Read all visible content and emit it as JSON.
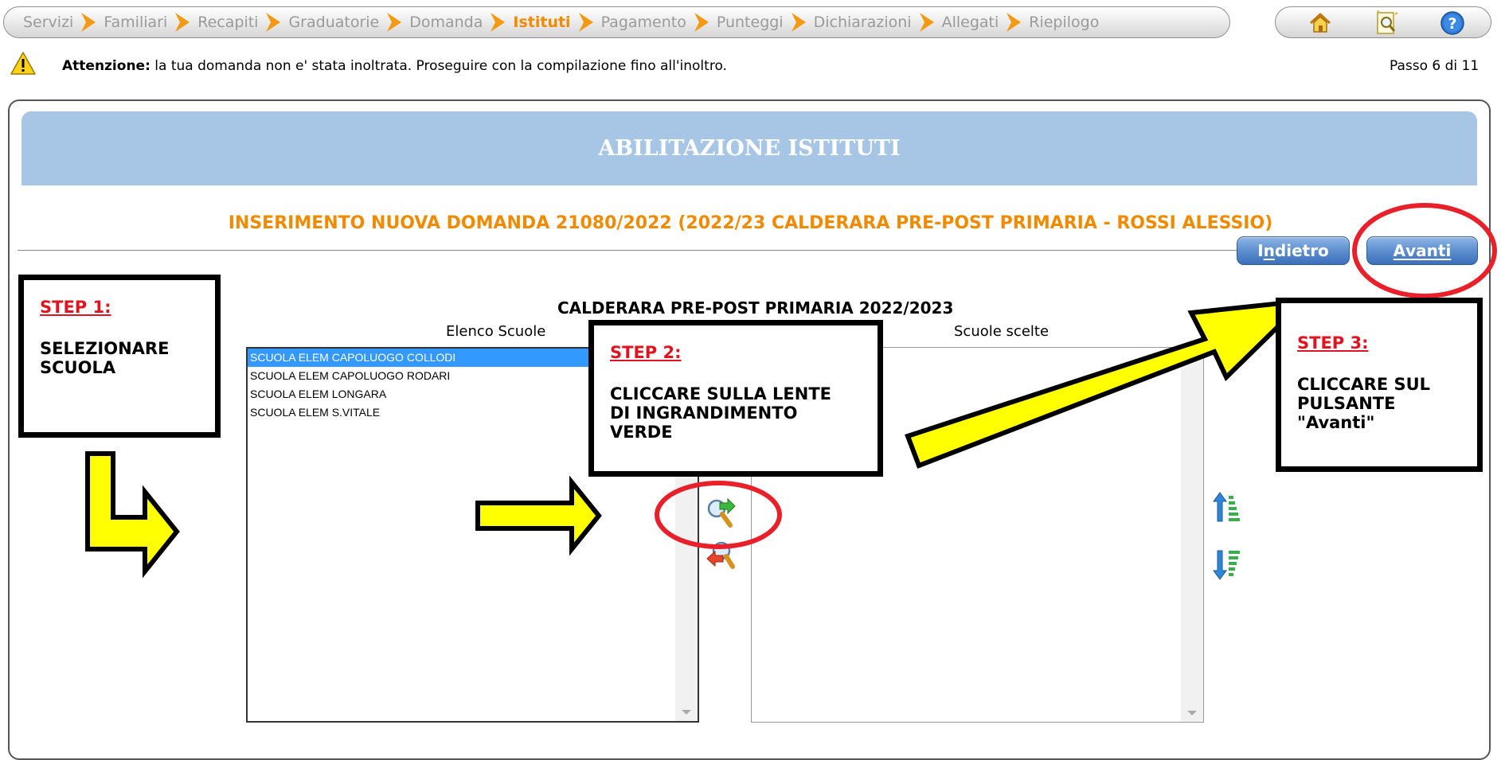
{
  "wizard": {
    "steps": [
      {
        "label": "Servizi",
        "active": false
      },
      {
        "label": "Familiari",
        "active": false
      },
      {
        "label": "Recapiti",
        "active": false
      },
      {
        "label": "Graduatorie",
        "active": false
      },
      {
        "label": "Domanda",
        "active": false
      },
      {
        "label": "Istituti",
        "active": true
      },
      {
        "label": "Pagamento",
        "active": false
      },
      {
        "label": "Punteggi",
        "active": false
      },
      {
        "label": "Dichiarazioni",
        "active": false
      },
      {
        "label": "Allegati",
        "active": false
      },
      {
        "label": "Riepilogo",
        "active": false
      }
    ]
  },
  "toolbar": {
    "icons": [
      "home-icon",
      "magnifier-document-icon",
      "help-icon"
    ]
  },
  "warning": {
    "bold": "Attenzione:",
    "text": " la tua domanda non e' stata inoltrata. Proseguire con la compilazione fino all'inoltro.",
    "step_indicator": "Passo 6 di 11"
  },
  "page": {
    "banner_title": "ABILITAZIONE ISTITUTI",
    "subtitle": "INSERIMENTO NUOVA DOMANDA 21080/2022 (2022/23 CALDERARA PRE-POST PRIMARIA - ROSSI ALESSIO)",
    "back_prefix": "I",
    "back_underlined": "n",
    "back_rest": "dietro",
    "next_underlined": "A",
    "next_rest": "vanti"
  },
  "selection": {
    "title": "CALDERARA PRE-POST PRIMARIA 2022/2023",
    "available_label": "Elenco Scuole",
    "chosen_label": "Scuole scelte",
    "available_items": [
      "SCUOLA ELEM CAPOLUOGO COLLODI",
      "SCUOLA ELEM CAPOLUOGO RODARI",
      "SCUOLA ELEM LONGARA",
      "SCUOLA ELEM S.VITALE"
    ],
    "selected_index": 0,
    "chosen_items": []
  },
  "annotations": {
    "step1": {
      "title": "STEP 1:",
      "body": "SELEZIONARE\nSCUOLA"
    },
    "step2": {
      "title": "STEP 2:",
      "body": "CLICCARE SULLA LENTE\nDI INGRANDIMENTO\nVERDE"
    },
    "step3": {
      "title": "STEP 3:",
      "body": "CLICCARE SUL\nPULSANTE\n\"Avanti\""
    },
    "colors": {
      "arrow_fill": "#ffff00",
      "highlight_ring": "#e8202a",
      "title_red": "#e0141e"
    }
  },
  "colors": {
    "banner": "#a7c6e6",
    "accent_orange": "#f08a00",
    "inactive_step": "#9a9a9a",
    "button_blue": "#4a7ec4",
    "selection_blue": "#3399ff"
  }
}
